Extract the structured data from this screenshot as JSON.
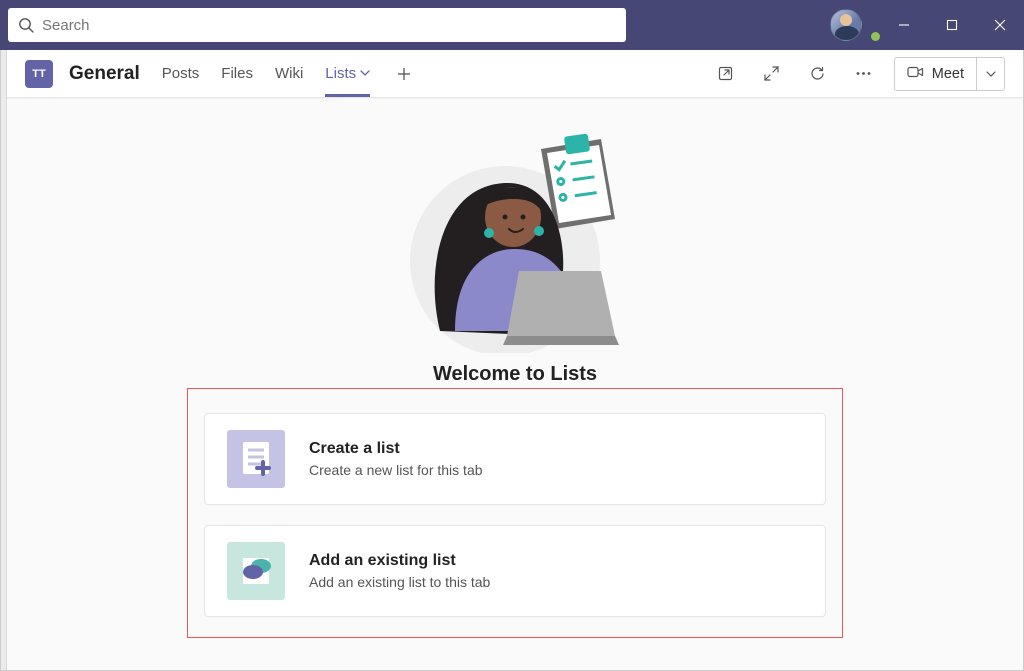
{
  "search": {
    "placeholder": "Search"
  },
  "team_badge": "TT",
  "channel_name": "General",
  "tabs": {
    "posts": "Posts",
    "files": "Files",
    "wiki": "Wiki",
    "lists": "Lists"
  },
  "active_tab": "lists",
  "meet_label": "Meet",
  "lists": {
    "welcome": "Welcome to Lists",
    "create_title": "Create a list",
    "create_desc": "Create a new list for this tab",
    "existing_title": "Add an existing list",
    "existing_desc": "Add an existing list to this tab"
  }
}
